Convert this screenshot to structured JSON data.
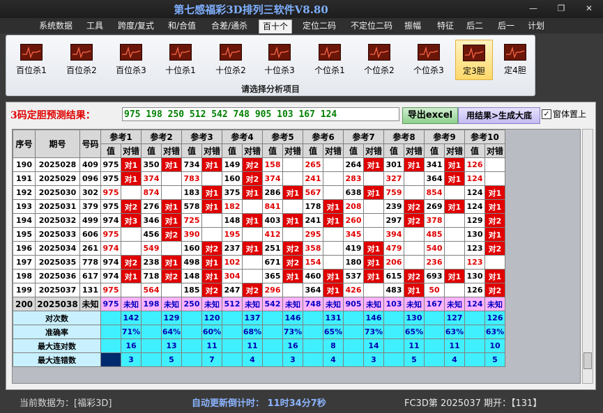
{
  "window": {
    "title": "第七感福彩3D排列三软件V8.80",
    "min": "—",
    "max": "❐",
    "close": "✕"
  },
  "menu": [
    "系统数据",
    "工具",
    "跨度/复式",
    "和/合值",
    "合差/通杀",
    "百十个",
    "定位二码",
    "不定位二码",
    "振幅",
    "特征",
    "后二",
    "后一",
    "计划"
  ],
  "active_menu": "百十个",
  "ribbon": {
    "items": [
      "百位杀1",
      "百位杀2",
      "百位杀3",
      "十位杀1",
      "十位杀2",
      "十位杀3",
      "个位杀1",
      "个位杀2",
      "个位杀3",
      "定3胆",
      "定4胆"
    ],
    "selected": "定3胆",
    "caption": "请选择分析项目"
  },
  "prediction": {
    "label": "3码定胆预测结果：",
    "value": "975 198 250 512 542 748 905 103 167 124",
    "export_button": "导出excel",
    "generate_button": "用结果>生成大底",
    "pin_checkbox": {
      "checked": true,
      "label": "窗体置上"
    }
  },
  "table": {
    "headers": {
      "seq": "序号",
      "issue": "期号",
      "number": "号码",
      "value": "值",
      "check": "对错"
    },
    "groups": [
      "参考1",
      "参考2",
      "参考3",
      "参考4",
      "参考5",
      "参考6",
      "参考7",
      "参考8",
      "参考9",
      "参考10"
    ],
    "rows": [
      {
        "seq": "190",
        "issue": "2025028",
        "number": "409",
        "v": [
          "975",
          "350",
          "734",
          "149",
          "158",
          "265",
          "264",
          "301",
          "341",
          "126"
        ],
        "c": [
          "对1",
          "对1",
          "对1",
          "对2",
          "",
          "",
          "对1",
          "对1",
          "对1",
          ""
        ]
      },
      {
        "seq": "191",
        "issue": "2025029",
        "number": "096",
        "v": [
          "975",
          "374",
          "783",
          "160",
          "374",
          "241",
          "283",
          "327",
          "364",
          "124"
        ],
        "c": [
          "对1",
          "",
          "",
          "对2",
          "",
          "",
          "",
          "",
          "对1",
          ""
        ]
      },
      {
        "seq": "192",
        "issue": "2025030",
        "number": "302",
        "v": [
          "975",
          "874",
          "183",
          "375",
          "286",
          "567",
          "638",
          "759",
          "854",
          "124"
        ],
        "c": [
          "",
          "",
          "对1",
          "对1",
          "对1",
          "",
          "对1",
          "",
          "",
          "对1"
        ]
      },
      {
        "seq": "193",
        "issue": "2025031",
        "number": "379",
        "v": [
          "975",
          "276",
          "578",
          "182",
          "841",
          "178",
          "208",
          "239",
          "269",
          "124"
        ],
        "c": [
          "对2",
          "对1",
          "对1",
          "",
          "",
          "对1",
          "",
          "对2",
          "对1",
          "对1"
        ]
      },
      {
        "seq": "194",
        "issue": "2025032",
        "number": "499",
        "v": [
          "974",
          "346",
          "725",
          "148",
          "403",
          "241",
          "260",
          "297",
          "378",
          "129"
        ],
        "c": [
          "对3",
          "对1",
          "",
          "对1",
          "对1",
          "对1",
          "",
          "对2",
          "",
          "对2"
        ]
      },
      {
        "seq": "195",
        "issue": "2025033",
        "number": "606",
        "v": [
          "975",
          "456",
          "390",
          "195",
          "412",
          "295",
          "345",
          "394",
          "485",
          "130"
        ],
        "c": [
          "",
          "对2",
          "",
          "",
          "",
          "",
          "",
          "",
          "",
          "对1"
        ]
      },
      {
        "seq": "196",
        "issue": "2025034",
        "number": "261",
        "v": [
          "974",
          "549",
          "160",
          "237",
          "251",
          "358",
          "419",
          "479",
          "540",
          "123"
        ],
        "c": [
          "",
          "",
          "对2",
          "对1",
          "对2",
          "",
          "对1",
          "",
          "",
          "对2"
        ]
      },
      {
        "seq": "197",
        "issue": "2025035",
        "number": "778",
        "v": [
          "974",
          "238",
          "498",
          "102",
          "671",
          "154",
          "180",
          "206",
          "236",
          "123"
        ],
        "c": [
          "对2",
          "对1",
          "对1",
          "",
          "对2",
          "",
          "对1",
          "",
          "",
          ""
        ]
      },
      {
        "seq": "198",
        "issue": "2025036",
        "number": "617",
        "v": [
          "974",
          "718",
          "148",
          "304",
          "365",
          "460",
          "537",
          "615",
          "693",
          "130"
        ],
        "c": [
          "对1",
          "对2",
          "对1",
          "",
          "对1",
          "对1",
          "对1",
          "对2",
          "对1",
          "对1"
        ]
      },
      {
        "seq": "199",
        "issue": "2025037",
        "number": "131",
        "v": [
          "975",
          "564",
          "185",
          "247",
          "296",
          "364",
          "426",
          "483",
          "50",
          "126"
        ],
        "c": [
          "",
          "",
          "对2",
          "对2",
          "",
          "对1",
          "",
          "对1",
          "",
          "对2"
        ]
      }
    ],
    "forecast_row": {
      "seq": "200",
      "issue": "2025038",
      "number": "未知",
      "v": [
        "975",
        "198",
        "250",
        "512",
        "542",
        "748",
        "905",
        "103",
        "167",
        "124"
      ],
      "c": "未知"
    },
    "stats": [
      {
        "label": "对次数",
        "values": [
          "142",
          "129",
          "120",
          "137",
          "146",
          "131",
          "146",
          "130",
          "127",
          "126"
        ]
      },
      {
        "label": "准确率",
        "values": [
          "71%",
          "64%",
          "60%",
          "68%",
          "73%",
          "65%",
          "73%",
          "65%",
          "63%",
          "63%"
        ]
      },
      {
        "label": "最大连对数",
        "values": [
          "16",
          "13",
          "11",
          "11",
          "16",
          "8",
          "14",
          "11",
          "11",
          "10"
        ]
      },
      {
        "label": "最大连错数",
        "values": [
          "3",
          "5",
          "7",
          "4",
          "3",
          "4",
          "3",
          "5",
          "4",
          "5"
        ]
      }
    ]
  },
  "status": {
    "left": "当前数据为：[福彩3D]",
    "countdown": "自动更新倒计时： 11时34分7秒",
    "right": "FC3D第 2025037 期开：【131】"
  }
}
